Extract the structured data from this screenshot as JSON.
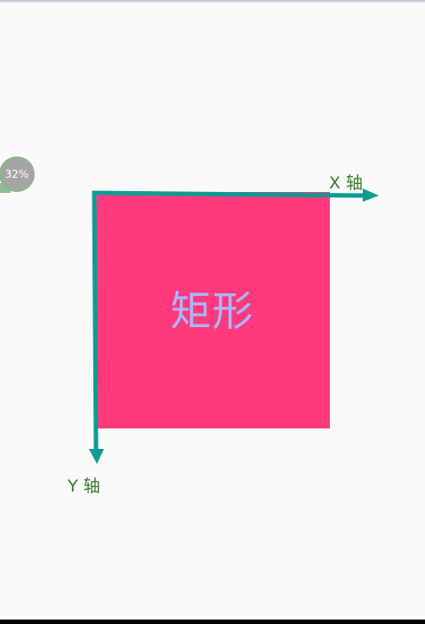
{
  "progress": {
    "label": "32%",
    "value": 0.32
  },
  "canvas": {
    "rect_label": "矩形",
    "x_axis_label": "X 轴",
    "y_axis_label": "Y 轴"
  },
  "colors": {
    "background": "#fafafa",
    "rect_fill": "#ff3a7c",
    "rect_text": "#a9b6ff",
    "axis_line": "#0e9b94",
    "axis_label": "#3a7a2c",
    "badge_fill": "#a5a5a5",
    "badge_border": "#86b986"
  }
}
